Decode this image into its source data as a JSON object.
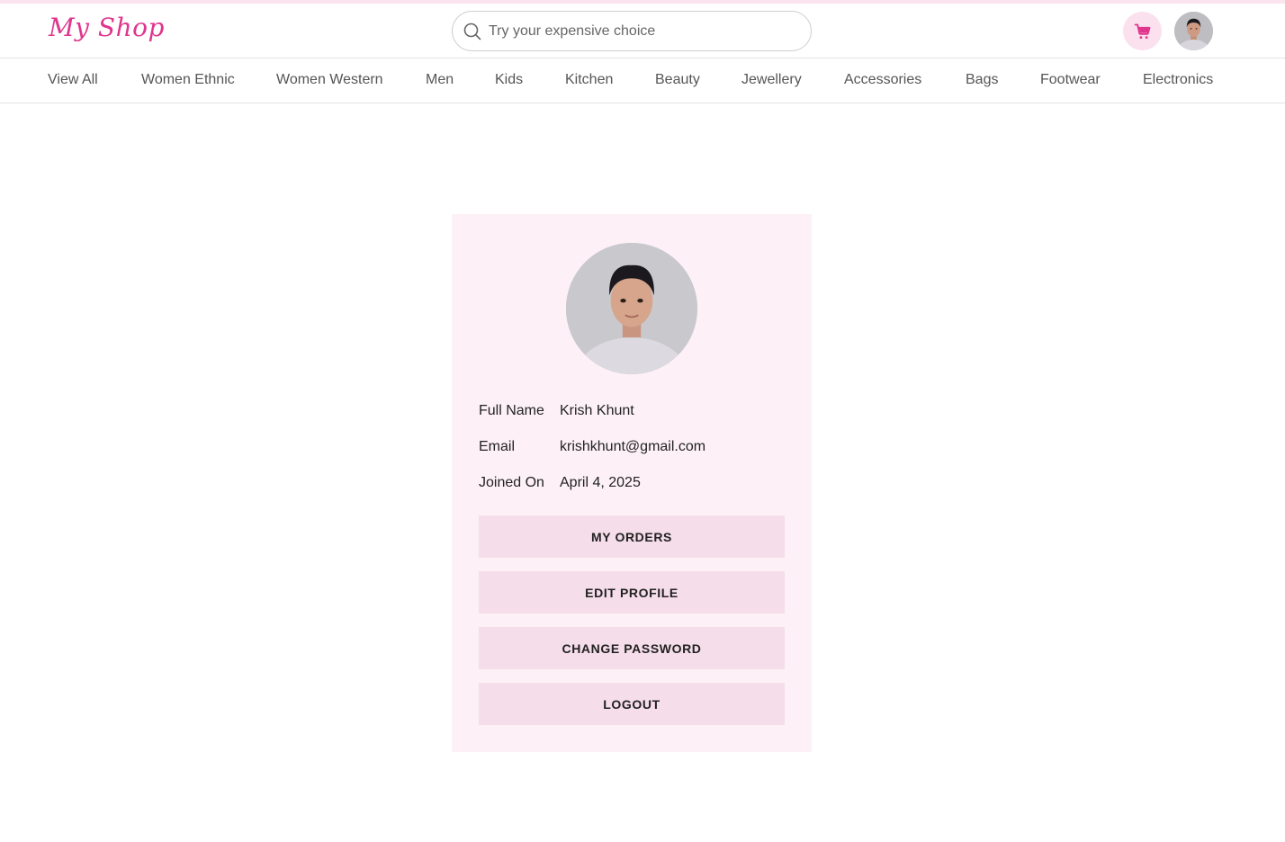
{
  "brand": {
    "logo_text": "My Shop",
    "accent_color": "#e0358d"
  },
  "search": {
    "placeholder": "Try your expensive choice",
    "value": ""
  },
  "header_icons": {
    "cart": "cart-icon",
    "avatar": "user-avatar"
  },
  "nav": {
    "items": [
      "View All",
      "Women Ethnic",
      "Women Western",
      "Men",
      "Kids",
      "Kitchen",
      "Beauty",
      "Jewellery",
      "Accessories",
      "Bags",
      "Footwear",
      "Electronics"
    ]
  },
  "profile": {
    "fields": [
      {
        "label": "Full Name",
        "value": "Krish Khunt"
      },
      {
        "label": "Email",
        "value": "krishkhunt@gmail.com"
      },
      {
        "label": "Joined On",
        "value": "April 4, 2025"
      }
    ],
    "buttons": {
      "orders": "MY ORDERS",
      "edit": "EDIT PROFILE",
      "password": "CHANGE PASSWORD",
      "logout": "LOGOUT"
    }
  }
}
